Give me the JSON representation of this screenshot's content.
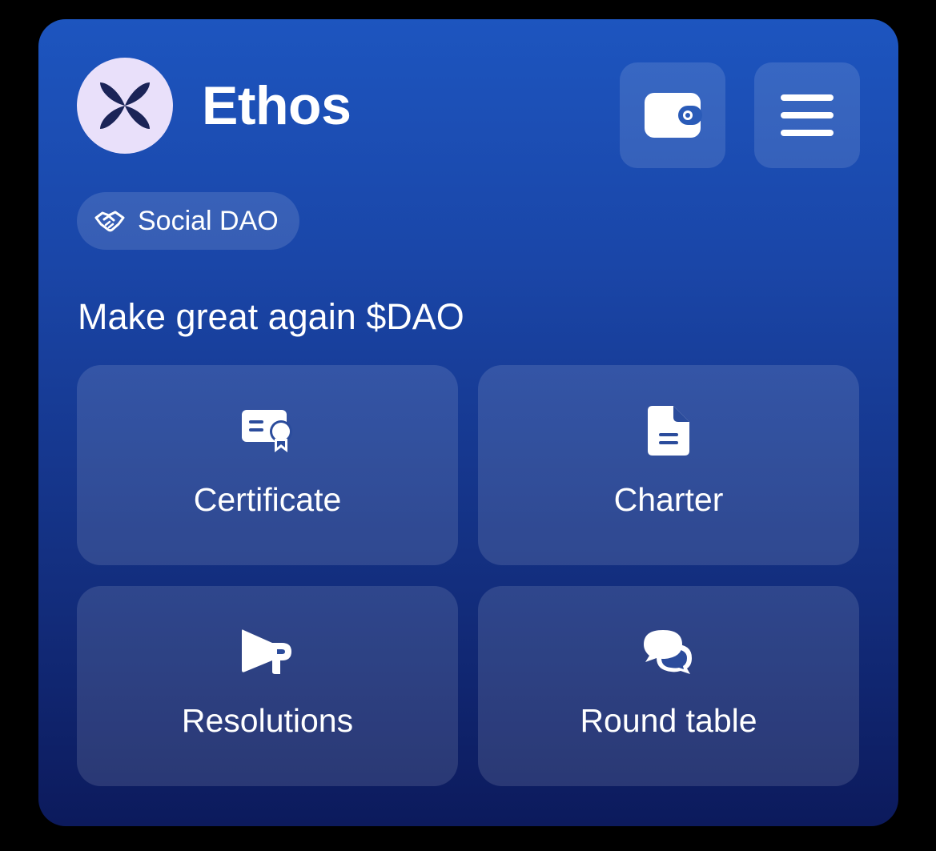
{
  "header": {
    "title": "Ethos",
    "logo_icon": "clover-x-logo-icon",
    "wallet_icon": "wallet-icon",
    "menu_icon": "hamburger-menu-icon"
  },
  "tag": {
    "label": "Social DAO",
    "icon": "handshake-icon"
  },
  "subtitle": "Make great again $DAO",
  "tiles": [
    {
      "label": "Certificate",
      "icon": "certificate-icon"
    },
    {
      "label": "Charter",
      "icon": "document-icon"
    },
    {
      "label": "Resolutions",
      "icon": "megaphone-icon"
    },
    {
      "label": "Round table",
      "icon": "chat-bubbles-icon"
    }
  ],
  "colors": {
    "background": "#000000",
    "card_top": "#1d55bf",
    "card_bottom": "#0c1a5c",
    "avatar_bg": "#e9e0fa",
    "logo": "#1b2457",
    "text": "#ffffff"
  }
}
